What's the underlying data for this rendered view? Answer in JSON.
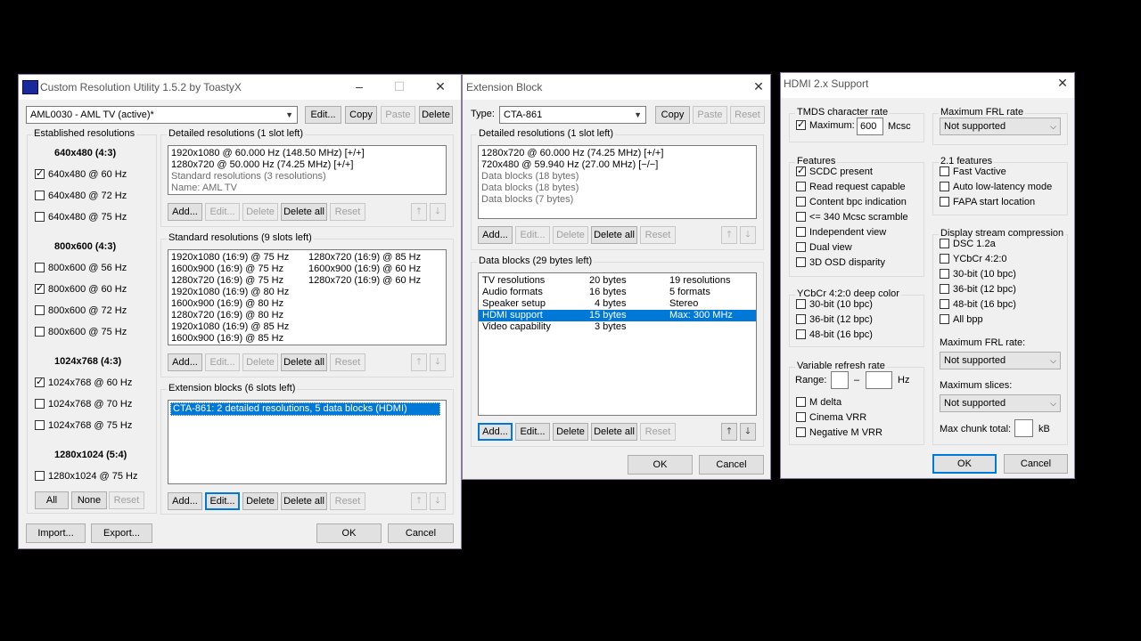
{
  "cru": {
    "title": "Custom Resolution Utility 1.5.2 by ToastyX",
    "display_select": "AML0030 - AML TV (active)*",
    "top_buttons": [
      "Edit...",
      "Copy",
      "Paste",
      "Delete"
    ],
    "established": {
      "title": "Established resolutions",
      "groups": [
        {
          "heading": "640x480 (4:3)",
          "items": [
            {
              "label": "640x480 @ 60 Hz",
              "checked": true
            },
            {
              "label": "640x480 @ 72 Hz",
              "checked": false
            },
            {
              "label": "640x480 @ 75 Hz",
              "checked": false
            }
          ]
        },
        {
          "heading": "800x600 (4:3)",
          "items": [
            {
              "label": "800x600 @ 56 Hz",
              "checked": false
            },
            {
              "label": "800x600 @ 60 Hz",
              "checked": true
            },
            {
              "label": "800x600 @ 72 Hz",
              "checked": false
            },
            {
              "label": "800x600 @ 75 Hz",
              "checked": false
            }
          ]
        },
        {
          "heading": "1024x768 (4:3)",
          "items": [
            {
              "label": "1024x768 @ 60 Hz",
              "checked": true
            },
            {
              "label": "1024x768 @ 70 Hz",
              "checked": false
            },
            {
              "label": "1024x768 @ 75 Hz",
              "checked": false
            }
          ]
        },
        {
          "heading": "1280x1024 (5:4)",
          "items": [
            {
              "label": "1280x1024 @ 75 Hz",
              "checked": false
            }
          ]
        }
      ],
      "buttons": [
        "All",
        "None",
        "Reset"
      ]
    },
    "detailed": {
      "title": "Detailed resolutions (1 slot left)",
      "items": [
        "1920x1080 @ 60.000 Hz (148.50 MHz) [+/+]",
        "1280x720 @ 50.000 Hz (74.25 MHz) [+/+]",
        "Standard resolutions (3 resolutions)",
        "Name: AML TV"
      ]
    },
    "standard": {
      "title": "Standard resolutions (9 slots left)",
      "col1": [
        "1920x1080 (16:9) @ 75 Hz",
        "1600x900 (16:9) @ 75 Hz",
        "1280x720 (16:9) @ 75 Hz",
        "1920x1080 (16:9) @ 80 Hz",
        "1600x900 (16:9) @ 80 Hz",
        "1280x720 (16:9) @ 80 Hz",
        "1920x1080 (16:9) @ 85 Hz",
        "1600x900 (16:9) @ 85 Hz"
      ],
      "col2": [
        "1280x720 (16:9) @ 85 Hz",
        "1600x900 (16:9) @ 60 Hz",
        "1280x720 (16:9) @ 60 Hz"
      ]
    },
    "extension": {
      "title": "Extension blocks (6 slots left)",
      "items": [
        "CTA-861: 2 detailed resolutions, 5 data blocks (HDMI)"
      ]
    },
    "list_buttons": [
      "Add...",
      "Edit...",
      "Delete",
      "Delete all",
      "Reset"
    ],
    "bottom_buttons": [
      "Import...",
      "Export...",
      "OK",
      "Cancel"
    ]
  },
  "ext": {
    "title": "Extension Block",
    "type_label": "Type:",
    "type_value": "CTA-861",
    "top_buttons": [
      "Copy",
      "Paste",
      "Reset"
    ],
    "detailed": {
      "title": "Detailed resolutions (1 slot left)",
      "items": [
        "1280x720 @ 60.000 Hz (74.25 MHz) [+/+]",
        "720x480 @ 59.940 Hz (27.00 MHz) [−/−]",
        "Data blocks (18 bytes)",
        "Data blocks (18 bytes)",
        "Data blocks (7 bytes)"
      ]
    },
    "datablocks": {
      "title": "Data blocks (29 bytes left)",
      "rows": [
        {
          "name": "TV resolutions",
          "bytes": "20 bytes",
          "info": "19 resolutions"
        },
        {
          "name": "Audio formats",
          "bytes": "16 bytes",
          "info": "5 formats"
        },
        {
          "name": "Speaker setup",
          "bytes": "4 bytes",
          "info": "Stereo"
        },
        {
          "name": "HDMI support",
          "bytes": "15 bytes",
          "info": "Max: 300 MHz"
        },
        {
          "name": "Video capability",
          "bytes": "3 bytes",
          "info": ""
        }
      ]
    },
    "list_buttons": [
      "Add...",
      "Edit...",
      "Delete",
      "Delete all",
      "Reset"
    ],
    "ok": "OK",
    "cancel": "Cancel"
  },
  "hdmi": {
    "title": "HDMI 2.x Support",
    "tmds": {
      "title": "TMDS character rate",
      "max_label": "Maximum:",
      "value": "600",
      "unit": "Mcsc"
    },
    "features": {
      "title": "Features",
      "items": [
        {
          "label": "SCDC present",
          "checked": true
        },
        {
          "label": "Read request capable",
          "checked": false
        },
        {
          "label": "Content bpc indication",
          "checked": false
        },
        {
          "label": "<= 340 Mcsc scramble",
          "checked": false
        },
        {
          "label": "Independent view",
          "checked": false
        },
        {
          "label": "Dual view",
          "checked": false
        },
        {
          "label": "3D OSD disparity",
          "checked": false
        }
      ]
    },
    "ycbcr": {
      "title": "YCbCr 4:2:0 deep color",
      "items": [
        {
          "label": "30-bit (10 bpc)",
          "checked": false
        },
        {
          "label": "36-bit (12 bpc)",
          "checked": false
        },
        {
          "label": "48-bit (16 bpc)",
          "checked": false
        }
      ]
    },
    "vrr": {
      "title": "Variable refresh rate",
      "range_label": "Range:",
      "dash": "–",
      "unit": "Hz",
      "items": [
        {
          "label": "M delta",
          "checked": false
        },
        {
          "label": "Cinema VRR",
          "checked": false
        },
        {
          "label": "Negative M VRR",
          "checked": false
        }
      ]
    },
    "frl": {
      "title": "Maximum FRL rate",
      "value": "Not supported"
    },
    "f21": {
      "title": "2.1 features",
      "items": [
        {
          "label": "Fast Vactive",
          "checked": false
        },
        {
          "label": "Auto low-latency mode",
          "checked": false
        },
        {
          "label": "FAPA start location",
          "checked": false
        }
      ]
    },
    "dsc": {
      "title": "Display stream compression",
      "items": [
        {
          "label": "DSC 1.2a",
          "checked": false
        },
        {
          "label": "YCbCr 4:2:0",
          "checked": false
        },
        {
          "label": "30-bit (10 bpc)",
          "checked": false
        },
        {
          "label": "36-bit (12 bpc)",
          "checked": false
        },
        {
          "label": "48-bit (16 bpc)",
          "checked": false
        },
        {
          "label": "All bpp",
          "checked": false
        }
      ],
      "frl_label": "Maximum FRL rate:",
      "frl_value": "Not supported",
      "slices_label": "Maximum slices:",
      "slices_value": "Not supported",
      "chunk_label": "Max chunk total:",
      "chunk_unit": "kB"
    },
    "ok": "OK",
    "cancel": "Cancel"
  }
}
